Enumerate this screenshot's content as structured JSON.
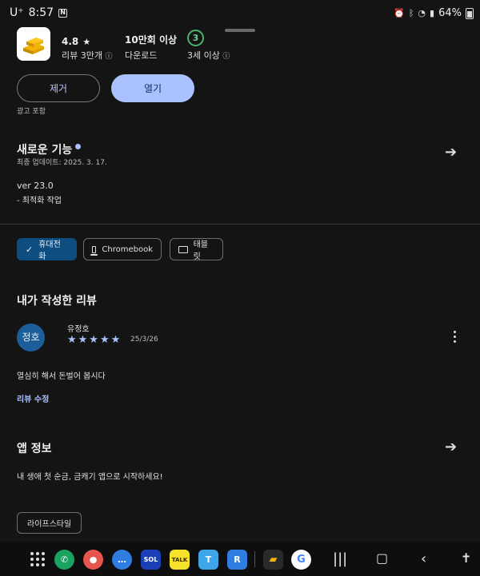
{
  "status_bar": {
    "carrier": "U⁺",
    "time": "8:57",
    "notif_badge": "N",
    "battery": "64%",
    "icons": [
      "alarm-icon",
      "bluetooth-icon",
      "wifi-icon",
      "signal-icon",
      "battery-icon"
    ]
  },
  "app": {
    "rating": "4.8",
    "rating_star": "★",
    "reviews_label": "리뷰 3만개",
    "downloads_value": "10만회 이상",
    "downloads_label": "다운로드",
    "age_value": "3",
    "age_label": "3세 이상"
  },
  "actions": {
    "remove_label": "제거",
    "open_label": "열기",
    "ads_label": "광고 포함"
  },
  "whats_new": {
    "title": "새로운 기능",
    "updated": "최종 업데이트: 2025. 3. 17.",
    "version": "ver 23.0",
    "note": "- 최적화 작업"
  },
  "device_chips": [
    {
      "label": "휴대전화",
      "selected": true
    },
    {
      "label": "Chromebook",
      "selected": false
    },
    {
      "label": "태블릿",
      "selected": false
    }
  ],
  "my_review": {
    "title": "내가 작성한 리뷰",
    "avatar_text": "정호",
    "author": "유정호",
    "stars": "★★★★★",
    "date": "25/3/26",
    "text": "열심히 해서 돈벌어 봅시다",
    "edit_label": "리뷰 수정"
  },
  "app_info": {
    "title": "앱 정보",
    "description": "내 생애 첫 순금, 금캐기 앱으로 시작하세요!",
    "tag": "라이프스타일"
  },
  "taskbar": {
    "apps": [
      {
        "name": "phone-app-icon",
        "color": "#1aa260",
        "glyph": "✆"
      },
      {
        "name": "contacts-app-icon",
        "color": "#e8554e",
        "glyph": "●"
      },
      {
        "name": "messages-app-icon",
        "color": "#2f7de1",
        "glyph": "…"
      },
      {
        "name": "sol-pay-app-icon",
        "color": "#1b3fb5",
        "glyph": "SOL"
      },
      {
        "name": "kakaotalk-app-icon",
        "color": "#f7e22b",
        "glyph": "TALK"
      },
      {
        "name": "t-app-icon",
        "color": "#3ea6e8",
        "glyph": "T"
      },
      {
        "name": "r-app-icon",
        "color": "#2f7de1",
        "glyph": "R"
      }
    ],
    "recent_apps": [
      {
        "name": "gold-app-icon",
        "color": "#2a2a2a",
        "glyph": "▰"
      },
      {
        "name": "google-app-icon",
        "color": "#ffffff",
        "glyph": "G"
      }
    ]
  }
}
